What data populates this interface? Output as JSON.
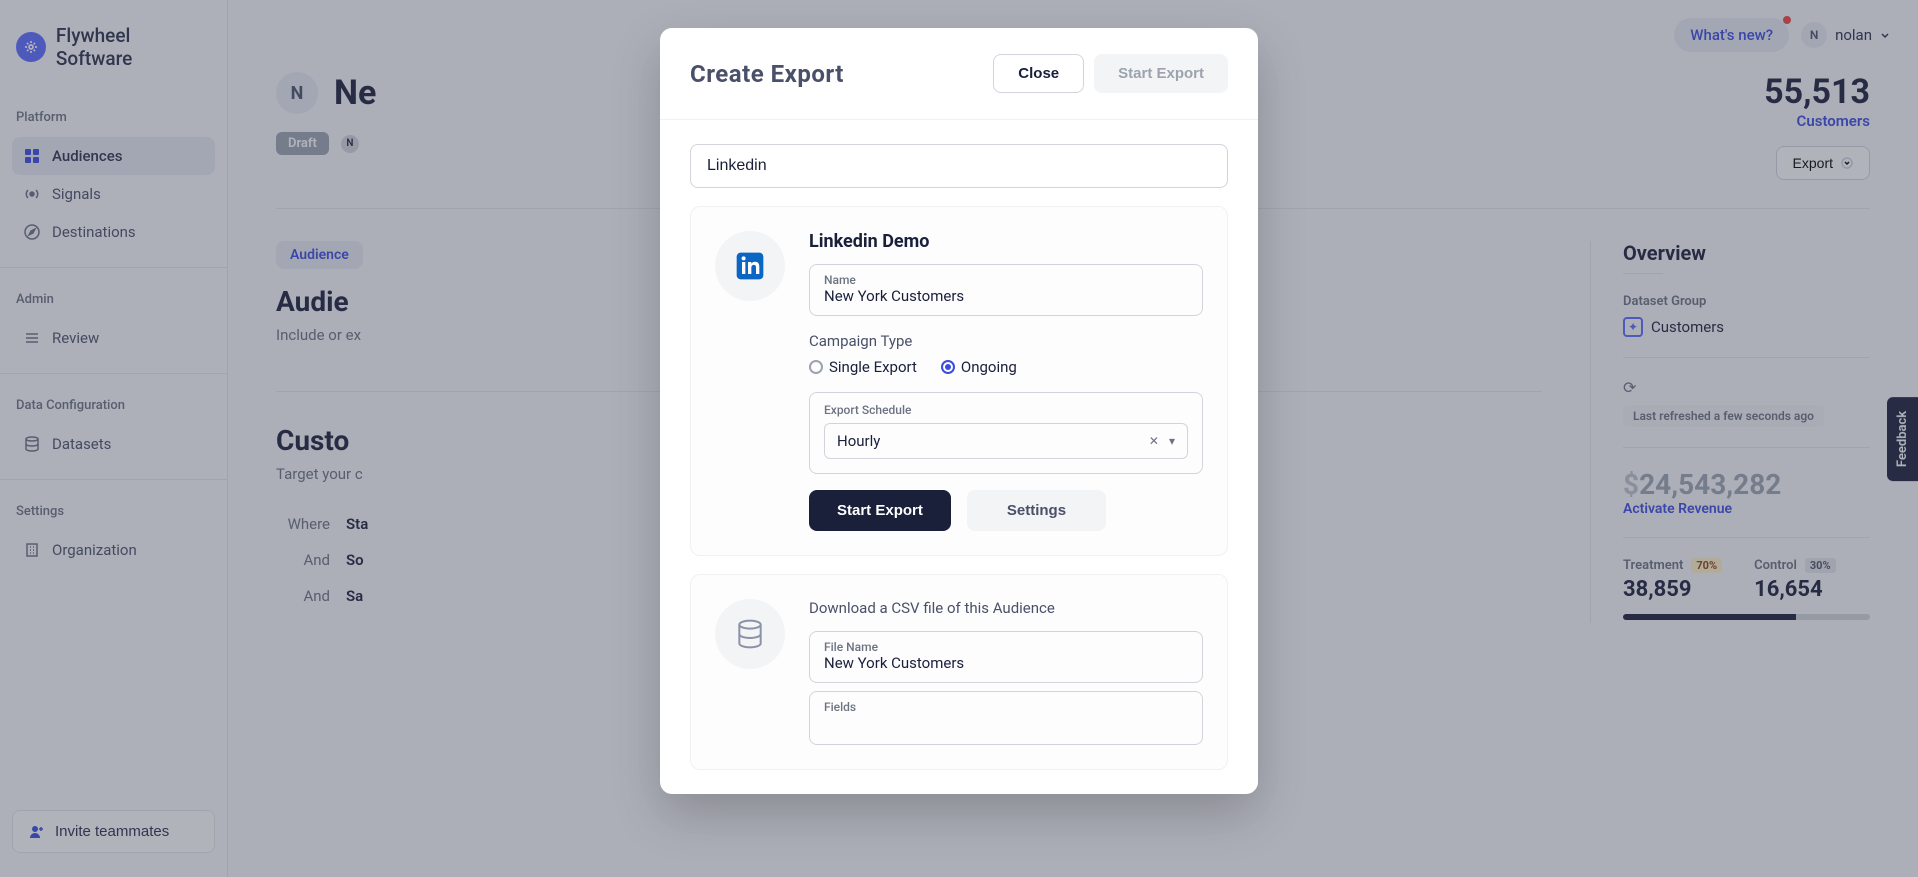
{
  "brand": "Flywheel Software",
  "sidebar": {
    "sections": {
      "platform": {
        "label": "Platform",
        "audiences": "Audiences",
        "signals": "Signals",
        "destinations": "Destinations"
      },
      "admin": {
        "label": "Admin",
        "review": "Review"
      },
      "data": {
        "label": "Data Configuration",
        "datasets": "Datasets"
      },
      "settings": {
        "label": "Settings",
        "organization": "Organization"
      }
    },
    "invite": "Invite teammates"
  },
  "topbar": {
    "whats_new": "What's new?",
    "user_initial": "N",
    "user_name": "nolan"
  },
  "page": {
    "avatar_initial": "N",
    "title_prefix": "Ne",
    "draft": "Draft",
    "meta_initial": "N",
    "count": "55,513",
    "count_label": "Customers",
    "export_btn": "Export"
  },
  "tabs": {
    "audience": "Audience"
  },
  "sections": {
    "aud_def_title_prefix": "Audie",
    "aud_def_sub_prefix": "Include or ex",
    "cust_title_prefix": "Custo",
    "cust_sub_prefix": "Target your c",
    "filters": {
      "where": "Where",
      "where_val": "Sta",
      "and1": "And",
      "and1_val": "So",
      "and2": "And",
      "and2_val": "Sa"
    }
  },
  "overview": {
    "title": "Overview",
    "dataset_group": "Dataset Group",
    "dataset_name": "Customers",
    "last_refreshed": "Last refreshed a few seconds ago",
    "revenue": "24,543,282",
    "activate": "Activate Revenue",
    "treatment": {
      "label": "Treatment",
      "pct": "70%",
      "val": "38,859"
    },
    "control": {
      "label": "Control",
      "pct": "30%",
      "val": "16,654"
    }
  },
  "feedback": "Feedback",
  "modal": {
    "title": "Create Export",
    "close": "Close",
    "start_export_top": "Start Export",
    "search_value": "Linkedin",
    "linkedin": {
      "name": "Linkedin Demo",
      "field_name_label": "Name",
      "field_name_value": "New York Customers",
      "campaign_type": "Campaign Type",
      "single": "Single Export",
      "ongoing": "Ongoing",
      "schedule_label": "Export Schedule",
      "schedule_value": "Hourly",
      "start_export": "Start Export",
      "settings": "Settings"
    },
    "csv": {
      "desc": "Download a CSV file of this Audience",
      "file_name_label": "File Name",
      "file_name_value": "New York Customers",
      "fields_label": "Fields"
    }
  }
}
